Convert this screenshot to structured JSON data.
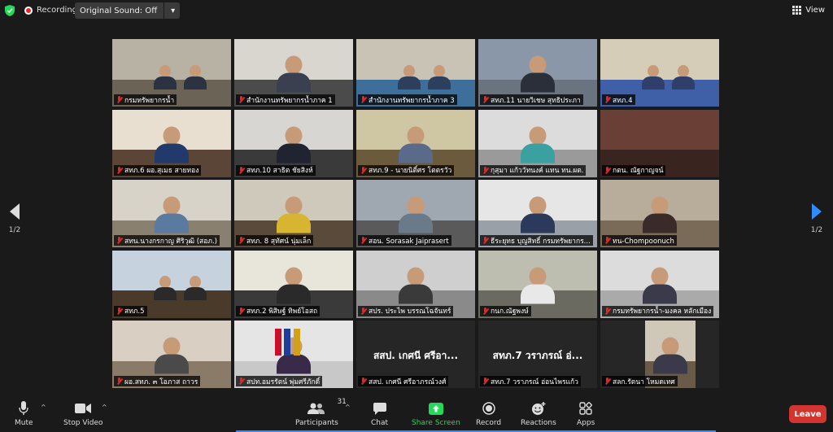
{
  "topbar": {
    "recording_label": "Recording",
    "sound_label": "Original Sound: Off",
    "sound_caret": "▾",
    "view_label": "View"
  },
  "pagination": {
    "left": "1/2",
    "right": "1/2"
  },
  "participants": [
    {
      "name": "กรมทรัพยากรน้ำ",
      "scene": "meeting",
      "wall": "#b8b2a4",
      "desk": "#6b6355",
      "shirt": "#2b3342"
    },
    {
      "name": "สำนักงานทรัพยากรน้ำภาค 1",
      "scene": "room",
      "wall": "#d9d6cf",
      "desk": "#4b4b4b",
      "shirt": "#3b4050"
    },
    {
      "name": "สำนักงานทรัพยากรน้ำภาค 3",
      "scene": "meeting",
      "wall": "#c9c3b6",
      "desk": "#3d6f9a",
      "shirt": "#2d3f5c"
    },
    {
      "name": "สทภ.11 นายวิเชษ สุทธิประภา",
      "scene": "person",
      "wall": "#8a97a8",
      "desk": "#6a7380",
      "shirt": "#2a2f3a"
    },
    {
      "name": "สทภ.4",
      "scene": "meeting",
      "wall": "#d6cdb8",
      "desk": "#3f5fa6",
      "shirt": "#2f3f6a"
    },
    {
      "name": "สทภ.6 ผอ.สุเมธ สายทอง",
      "scene": "person",
      "wall": "#e8dfd0",
      "desk": "#5a4536",
      "shirt": "#213a6b"
    },
    {
      "name": "สทภ.10 สาธิต ชัยสิงห์",
      "scene": "person",
      "wall": "#d8d6d3",
      "desk": "#3a3a3a",
      "shirt": "#1f2430"
    },
    {
      "name": "สทภ.9 - นายนิติ์ศร โตตรวัว",
      "scene": "person",
      "wall": "#cfc7a3",
      "desk": "#6b5a3c",
      "shirt": "#5a6a8a"
    },
    {
      "name": "กุสุมา แก้ววัทนงค์ แทน ทน.ผต.",
      "scene": "person",
      "wall": "#dcdcdc",
      "desk": "#9a9a9a",
      "shirt": "#3aa0a0"
    },
    {
      "name": "กตน. ณัฐกาญจน์",
      "scene": "blank",
      "wall": "#6a4036",
      "desk": "#3a2420",
      "shirt": "#000"
    },
    {
      "name": "สทน.นางกรกาญ ศิริวุฒิ (สอภ.)",
      "scene": "person",
      "wall": "#d7d3c8",
      "desk": "#8a8070",
      "shirt": "#5a7aa0"
    },
    {
      "name": "สทภ. 8 สุทัศน์ นุ่มเล็ก",
      "scene": "person",
      "wall": "#cfc9bb",
      "desk": "#5a4a3a",
      "shirt": "#d8b530"
    },
    {
      "name": "สอน. Sorasak Jaiprasert",
      "scene": "person",
      "wall": "#9fa8b0",
      "desk": "#5a5a5a",
      "shirt": "#6a7a8a"
    },
    {
      "name": "ธีระยุทธ บุญสิทธิ์ กรมทรัพยากร...",
      "scene": "person",
      "wall": "#e6e6e6",
      "desk": "#9aa0a8",
      "shirt": "#2b3a5a"
    },
    {
      "name": "ทน-Chompoonuch",
      "scene": "person",
      "wall": "#b8ad9a",
      "desk": "#7a6a58",
      "shirt": "#3a2a2a"
    },
    {
      "name": "สทภ.5",
      "scene": "meeting",
      "wall": "#c6d2de",
      "desk": "#4a3a2a",
      "shirt": "#2a2a2a"
    },
    {
      "name": "สทภ.2 พิสิษฐ์ ทิพย์โอสถ",
      "scene": "person",
      "wall": "#e8e6da",
      "desk": "#3a3a3a",
      "shirt": "#2a2a2a"
    },
    {
      "name": "สปร. ประไพ บรรณโฉจันทร์",
      "scene": "person",
      "wall": "#cfcfcf",
      "desk": "#8a8a8a",
      "shirt": "#3a3a3a"
    },
    {
      "name": "กนก.ณัฐพงษ์",
      "scene": "person",
      "wall": "#bdbdb0",
      "desk": "#6a6a60",
      "shirt": "#e8e8e8"
    },
    {
      "name": "กรมทรัพยากรน้ำ-มงคล หลักเมือง",
      "scene": "person",
      "wall": "#dcdcdc",
      "desk": "#aaaaaa",
      "shirt": "#3a3a4a"
    },
    {
      "name": "ผอ.สทภ. ๓ โอภาส ถาวร",
      "scene": "person",
      "wall": "#d9cfc2",
      "desk": "#8a7a68",
      "shirt": "#4a4a4a"
    },
    {
      "name": "สปท.อมรรัตน์ พุ่มศรีภักดิ์",
      "scene": "flags",
      "wall": "#e5e5e5",
      "desk": "#c8c8c8",
      "shirt": "#3a2a4a"
    },
    {
      "name": "สสป. เกศนี ศรีอาภรณ์วงศ์",
      "scene": "text",
      "bigname": "สสป. เกศนี ศรีอา...",
      "wall": "#262626",
      "desk": "#262626",
      "shirt": "#000"
    },
    {
      "name": "สทภ.7 วราภรณ์ อ่อนไพรแก้ว",
      "scene": "text",
      "bigname": "สทภ.7 วราภรณ์ อ่...",
      "wall": "#262626",
      "desk": "#262626",
      "shirt": "#000"
    },
    {
      "name": "สลก.รัตนา โหมดเทศ",
      "scene": "smallvideo",
      "wall": "#cfc7b8",
      "desk": "#6a5a48",
      "shirt": "#3a3a4a"
    }
  ],
  "toolbar": {
    "mute": "Mute",
    "stop_video": "Stop Video",
    "participants": "Participants",
    "participants_count": "31",
    "chat": "Chat",
    "share_screen": "Share Screen",
    "record": "Record",
    "reactions": "Reactions",
    "apps": "Apps",
    "leave": "Leave",
    "caret": "^"
  },
  "colors": {
    "active_speaker": "#c8e16a",
    "share_green": "#23d959",
    "leave_red": "#d23530",
    "recording_red": "#e02828",
    "accent_blue": "#2d8cff"
  }
}
